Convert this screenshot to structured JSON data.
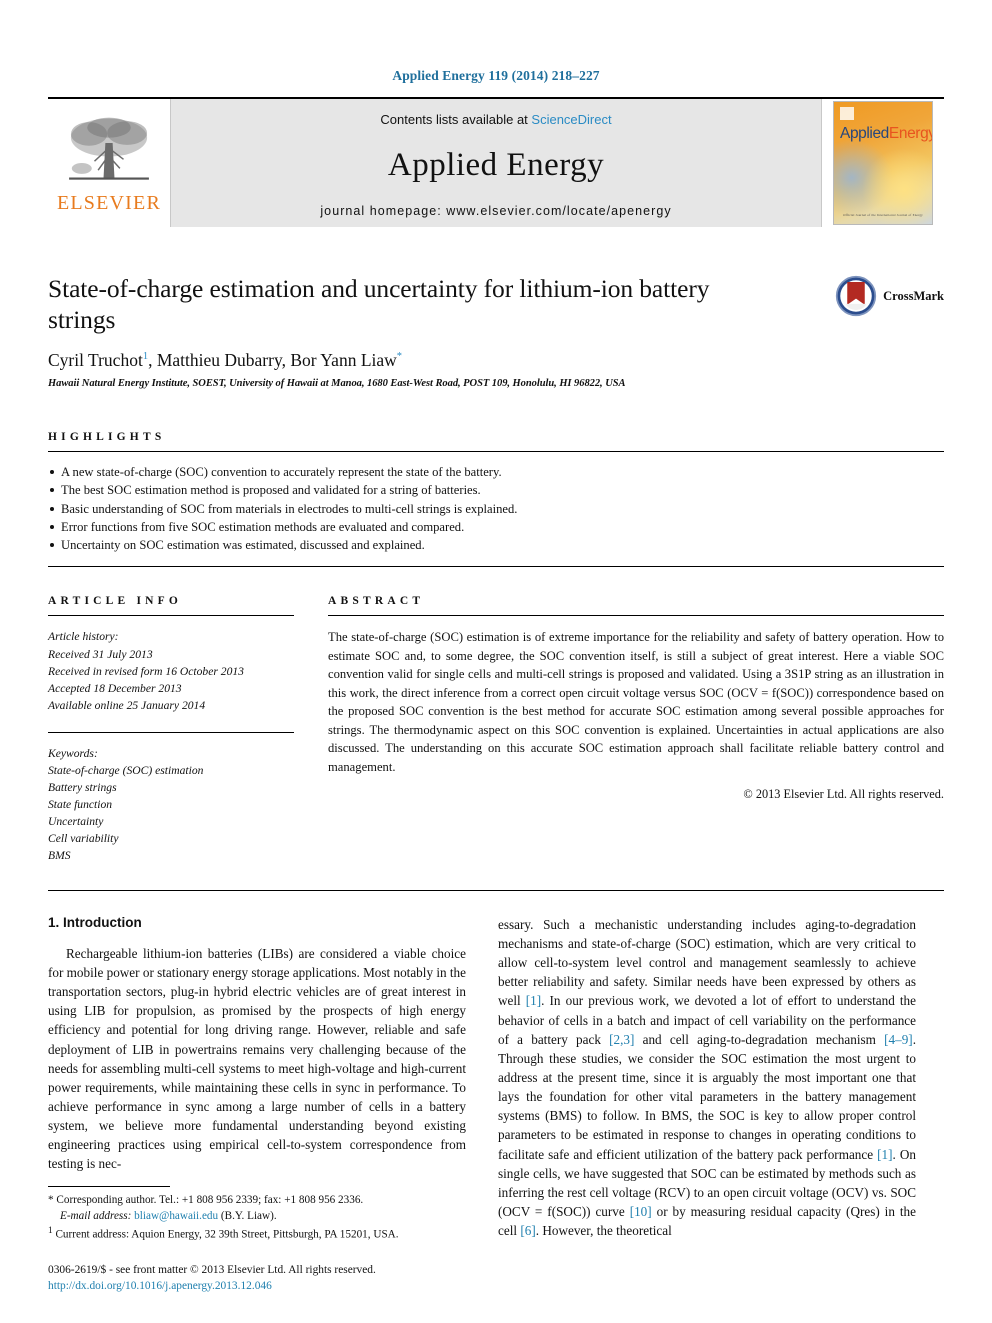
{
  "running_head": "Applied Energy 119 (2014) 218–227",
  "masthead": {
    "publisher_name": "ELSEVIER",
    "contents_prefix": "Contents lists available at ",
    "sciencedirect": "ScienceDirect",
    "journal_name": "Applied Energy",
    "homepage": "journal homepage: www.elsevier.com/locate/apenergy",
    "cover_title_a": "Applied",
    "cover_title_b": "Energy",
    "cover_footer": "Official Journal of the International Journal of Energy"
  },
  "crossmark": {
    "label": "CrossMark"
  },
  "article": {
    "title": "State-of-charge estimation and uncertainty for lithium-ion battery strings",
    "authors_parts": {
      "a1": "Cyril Truchot",
      "a1_sup": "1",
      "sep1": ", ",
      "a2": "Matthieu Dubarry",
      "sep2": ", ",
      "a3": "Bor Yann Liaw",
      "a3_sup": "*"
    },
    "affiliation": "Hawaii Natural Energy Institute, SOEST, University of Hawaii at Manoa, 1680 East-West Road, POST 109, Honolulu, HI 96822, USA"
  },
  "highlights": {
    "heading": "HIGHLIGHTS",
    "items": [
      "A new state-of-charge (SOC) convention to accurately represent the state of the battery.",
      "The best SOC estimation method is proposed and validated for a string of batteries.",
      "Basic understanding of SOC from materials in electrodes to multi-cell strings is explained.",
      "Error functions from five SOC estimation methods are evaluated and compared.",
      "Uncertainty on SOC estimation was estimated, discussed and explained."
    ]
  },
  "article_info": {
    "heading": "ARTICLE INFO",
    "history_label": "Article history:",
    "history": [
      "Received 31 July 2013",
      "Received in revised form 16 October 2013",
      "Accepted 18 December 2013",
      "Available online 25 January 2014"
    ],
    "keywords_label": "Keywords:",
    "keywords": [
      "State-of-charge (SOC) estimation",
      "Battery strings",
      "State function",
      "Uncertainty",
      "Cell variability",
      "BMS"
    ]
  },
  "abstract": {
    "heading": "ABSTRACT",
    "text": "The state-of-charge (SOC) estimation is of extreme importance for the reliability and safety of battery operation. How to estimate SOC and, to some degree, the SOC convention itself, is still a subject of great interest. Here a viable SOC convention valid for single cells and multi-cell strings is proposed and validated. Using a 3S1P string as an illustration in this work, the direct inference from a correct open circuit voltage versus SOC (OCV = f(SOC)) correspondence based on the proposed SOC convention is the best method for accurate SOC estimation among several possible approaches for strings. The thermodynamic aspect on this SOC convention is explained. Uncertainties in actual applications are also discussed. The understanding on this accurate SOC estimation approach shall facilitate reliable battery control and management.",
    "copyright": "© 2013 Elsevier Ltd. All rights reserved."
  },
  "body": {
    "section_heading": "1. Introduction",
    "left_paragraph": "Rechargeable lithium-ion batteries (LIBs) are considered a viable choice for mobile power or stationary energy storage applications. Most notably in the transportation sectors, plug-in hybrid electric vehicles are of great interest in using LIB for propulsion, as promised by the prospects of high energy efficiency and potential for long driving range. However, reliable and safe deployment of LIB in powertrains remains very challenging because of the needs for assembling multi-cell systems to meet high-voltage and high-current power requirements, while maintaining these cells in sync in performance. To achieve performance in sync among a large number of cells in a battery system, we believe more fundamental understanding beyond existing engineering practices using empirical cell-to-system correspondence from testing is nec-",
    "right_segments": [
      {
        "t": "essary. Such a mechanistic understanding includes aging-to-degradation mechanisms and state-of-charge (SOC) estimation, which are very critical to allow cell-to-system level control and management seamlessly to achieve better reliability and safety. Similar needs have been expressed by others as well "
      },
      {
        "t": "[1]",
        "ref": true
      },
      {
        "t": ". In our previous work, we devoted a lot of effort to understand the behavior of cells in a batch and impact of cell variability on the performance of a battery pack "
      },
      {
        "t": "[2,3]",
        "ref": true
      },
      {
        "t": " and cell aging-to-degradation mechanism "
      },
      {
        "t": "[4–9]",
        "ref": true
      },
      {
        "t": ". Through these studies, we consider the SOC estimation the most urgent to address at the present time, since it is arguably the most important one that lays the foundation for other vital parameters in the battery management systems (BMS) to follow. In BMS, the SOC is key to allow proper control parameters to be estimated in response to changes in operating conditions to facilitate safe and efficient utilization of the battery pack performance "
      },
      {
        "t": "[1]",
        "ref": true
      },
      {
        "t": ". On single cells, we have suggested that SOC can be estimated by methods such as inferring the rest cell voltage (RCV) to an open circuit voltage (OCV) vs. SOC (OCV = f(SOC)) curve "
      },
      {
        "t": "[10]",
        "ref": true
      },
      {
        "t": " or by measuring residual capacity (Qres) in the cell "
      },
      {
        "t": "[6]",
        "ref": true
      },
      {
        "t": ". However, the theoretical"
      }
    ]
  },
  "footnotes": {
    "corresponding": "* Corresponding author. Tel.: +1 808 956 2339; fax: +1 808 956 2336.",
    "email_label": "E-mail address:",
    "email": "bliaw@hawaii.edu",
    "email_suffix": "(B.Y. Liaw).",
    "current_address_sup": "1",
    "current_address": "Current address: Aquion Energy, 32 39th Street, Pittsburgh, PA 15201, USA.",
    "imprint": "0306-2619/$ - see front matter © 2013 Elsevier Ltd. All rights reserved.",
    "doi": "http://dx.doi.org/10.1016/j.apenergy.2013.12.046"
  },
  "colors": {
    "link": "#1f7fae",
    "sciencedirect": "#2a8bc4",
    "elsevier_orange": "#e87b1e",
    "masthead_bg": "#e6e6e6"
  }
}
